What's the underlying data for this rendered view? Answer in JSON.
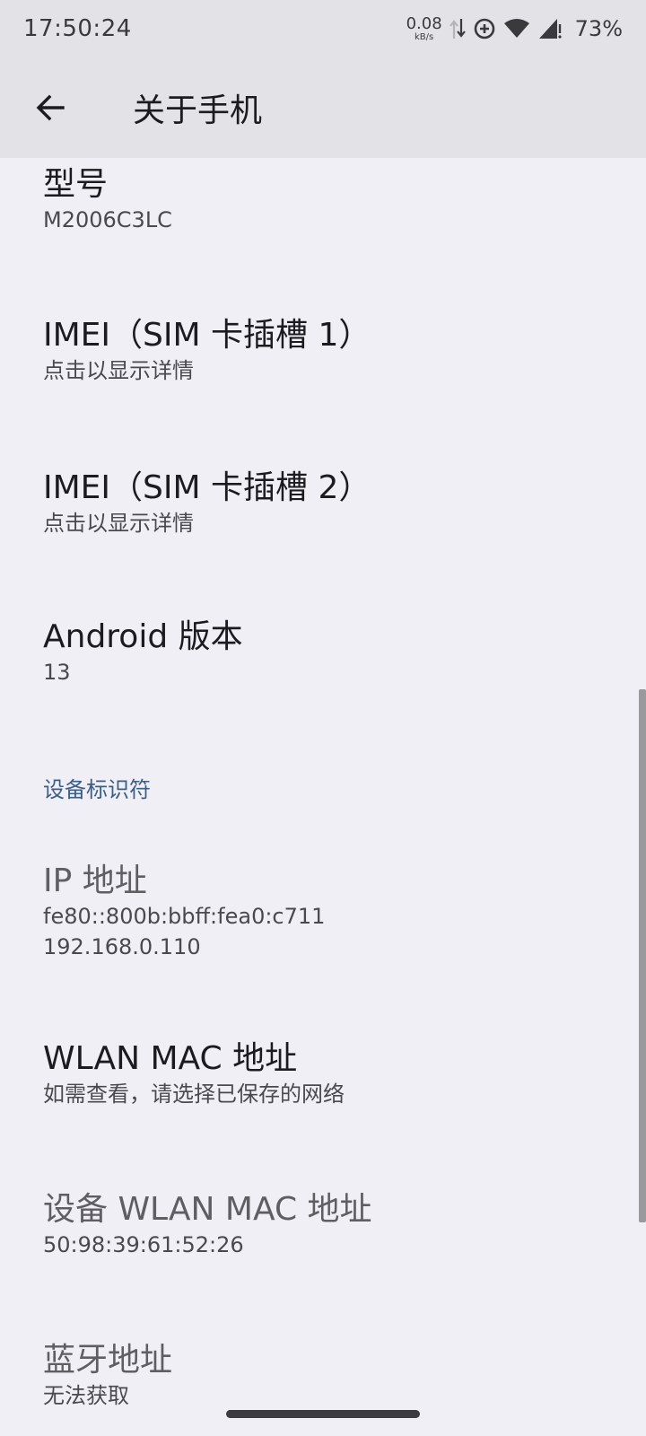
{
  "status_bar": {
    "time": "17:50:24",
    "net_speed_value": "0.08",
    "net_speed_unit": "kB/s",
    "battery": "73%",
    "icons": [
      "data-transfer-icon",
      "data-saver-icon",
      "wifi-icon",
      "cell-signal-icon"
    ]
  },
  "app_bar": {
    "title": "关于手机",
    "back_icon": "arrow-left-icon"
  },
  "items": [
    {
      "title": "型号",
      "summary": "M2006C3LC"
    },
    {
      "title": "IMEI（SIM 卡插槽 1）",
      "summary": "点击以显示详情"
    },
    {
      "title": "IMEI（SIM 卡插槽 2）",
      "summary": "点击以显示详情"
    },
    {
      "title": "Android 版本",
      "summary": "13"
    }
  ],
  "category": {
    "label": "设备标识符"
  },
  "identifiers": [
    {
      "title": "IP 地址",
      "summary_line1": "fe80::800b:bbff:fea0:c711",
      "summary_line2": "192.168.0.110"
    },
    {
      "title": "WLAN MAC 地址",
      "summary": "如需查看，请选择已保存的网络"
    },
    {
      "title": "设备 WLAN MAC 地址",
      "summary": "50:98:39:61:52:26"
    },
    {
      "title": "蓝牙地址",
      "summary": "无法获取"
    }
  ],
  "colors": {
    "background": "#f0eff5",
    "app_bar": "#e3e2e7",
    "category_accent": "#3d5f86"
  }
}
